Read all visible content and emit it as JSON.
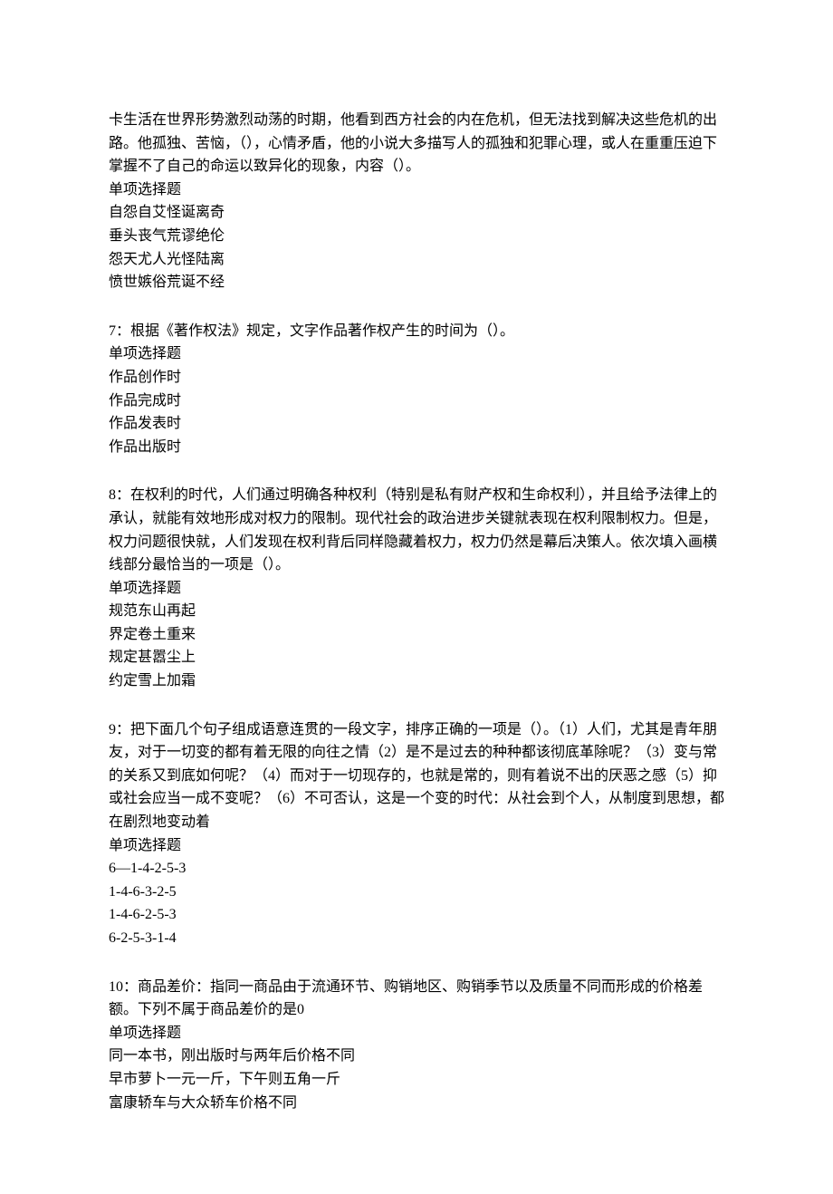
{
  "q6": {
    "stem_line1": "卡生活在世界形势激烈动荡的时期，他看到西方社会的内在危机，但无法找到解决这些危机的出路。他孤独、苦恼，（），心情矛盾，他的小说大多描写人的孤独和犯罪心理，或人在重重压迫下掌握不了自己的命运以致异化的现象，内容（）。",
    "type_label": "单项选择题",
    "opts": [
      "自怨自艾怪诞离奇",
      "垂头丧气荒谬绝伦",
      "怨天尤人光怪陆离",
      "愤世嫉俗荒诞不经"
    ]
  },
  "q7": {
    "stem": "7：根据《著作权法》规定，文字作品著作权产生的时间为（）。",
    "type_label": "单项选择题",
    "opts": [
      "作品创作时",
      "作品完成时",
      "作品发表时",
      "作品出版时"
    ]
  },
  "q8": {
    "stem": "8：在权利的时代，人们通过明确各种权利（特别是私有财产权和生命权利），并且给予法律上的承认，就能有效地形成对权力的限制。现代社会的政治进步关键就表现在权利限制权力。但是，权力问题很快就，人们发现在权利背后同样隐藏着权力，权力仍然是幕后决策人。依次填入画横线部分最恰当的一项是（）。",
    "type_label": "单项选择题",
    "opts": [
      "规范东山再起",
      "界定卷土重来",
      "规定甚嚣尘上",
      "约定雪上加霜"
    ]
  },
  "q9": {
    "stem": "9：把下面几个句子组成语意连贯的一段文字，排序正确的一项是（）。（1）人们，尤其是青年朋友，对于一切变的都有着无限的向往之情（2）是不是过去的种种都该彻底革除呢？（3）变与常的关系又到底如何呢？（4）而对于一切现存的，也就是常的，则有着说不出的厌恶之感（5）抑或社会应当一成不变呢？（6）不可否认，这是一个变的时代：从社会到个人，从制度到思想，都在剧烈地变动着",
    "type_label": "单项选择题",
    "opts": [
      "6—1-4-2-5-3",
      "1-4-6-3-2-5",
      "1-4-6-2-5-3",
      "6-2-5-3-1-4"
    ]
  },
  "q10": {
    "stem": "10：商品差价：指同一商品由于流通环节、购销地区、购销季节以及质量不同而形成的价格差额。下列不属于商品差价的是0",
    "type_label": "单项选择题",
    "opts": [
      "同一本书，刚出版时与两年后价格不同",
      "早市萝卜一元一斤，下午则五角一斤",
      "富康轿车与大众轿车价格不同"
    ]
  }
}
